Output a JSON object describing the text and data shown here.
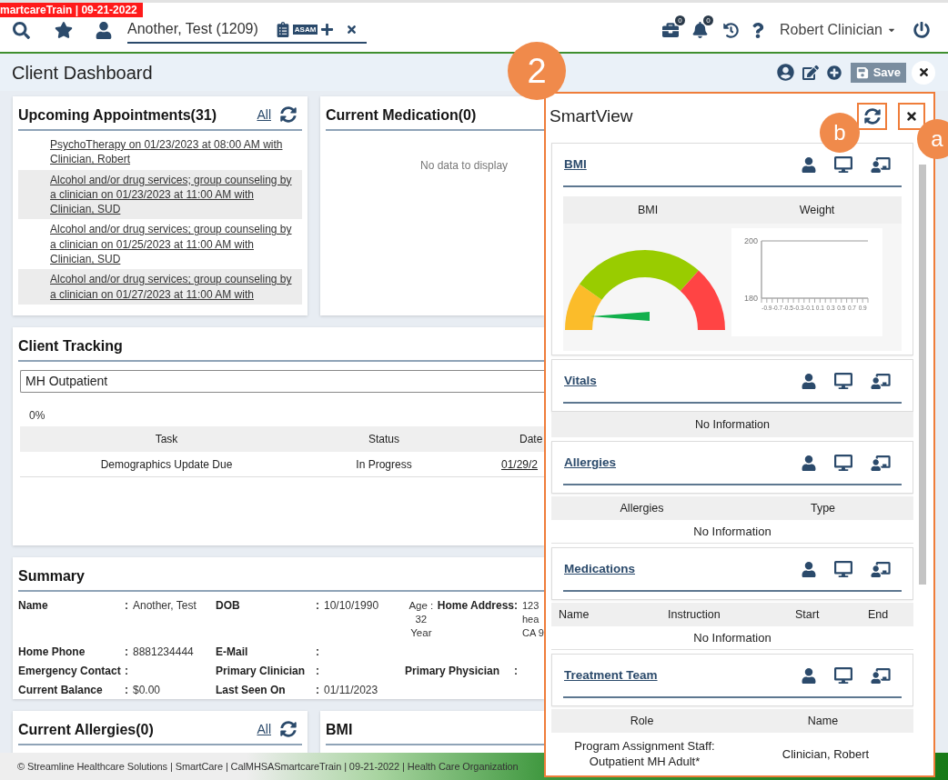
{
  "env_label": "martcareTrain | 09-21-2022",
  "topbar": {
    "client": "Another, Test (1209)",
    "badge": "ASAM",
    "briefcase_count": "0",
    "bell_count": "0",
    "user": "Robert Clinician"
  },
  "page": {
    "title": "Client Dashboard",
    "save": "Save"
  },
  "appointments": {
    "title": "Upcoming Appointments(31)",
    "all_link": "All",
    "items": [
      "PsychoTherapy on 01/23/2023 at 08:00 AM with Clinician, Robert",
      "Alcohol and/or drug services; group counseling by a clinician on 01/23/2023 at 11:00 AM with Clinician, SUD",
      "Alcohol and/or drug services; group counseling by a clinician on 01/25/2023 at 11:00 AM with Clinician, SUD",
      "Alcohol and/or drug services; group counseling by a clinician on 01/27/2023 at 11:00 AM with"
    ]
  },
  "medication": {
    "title": "Current Medication(0)",
    "empty": "No data to display"
  },
  "tracking": {
    "title": "Client Tracking",
    "program": "MH Outpatient",
    "progress": "0%",
    "columns": [
      "Task",
      "Status",
      "Date"
    ],
    "rows": [
      [
        "Demographics Update Due",
        "In Progress",
        "01/29/2"
      ]
    ]
  },
  "summary": {
    "title": "Summary",
    "rows": [
      [
        {
          "label": "Name",
          "sep": ":",
          "value": "Another, Test"
        },
        {
          "label": "DOB",
          "sep": ":",
          "value": "10/10/1990"
        },
        {
          "note": "Age : 32 Year",
          "label": "Home Address",
          "sep": ":",
          "value": "123 hea CA 9"
        }
      ],
      [
        {
          "label": "Home Phone",
          "sep": ":",
          "value": "8881234444"
        },
        {
          "label": "E-Mail",
          "sep": ":"
        }
      ],
      [
        {
          "label": "Emergency Contact",
          "sep": ":"
        },
        {
          "label": "Primary Clinician",
          "sep": ":"
        },
        {
          "label": "Primary Physician",
          "sep": ":"
        }
      ],
      [
        {
          "label": "Current Balance",
          "sep": ":",
          "value": "$0.00"
        },
        {
          "label": "Last Seen On",
          "sep": ":",
          "value": "01/11/2023"
        }
      ]
    ]
  },
  "allergies": {
    "title": "Current Allergies(0)",
    "all_link": "All"
  },
  "bmi_card": {
    "title": "BMI"
  },
  "footer": "© Streamline Healthcare Solutions | SmartCare | CalMHSASmartcareTrain | 09-21-2022 | Health Care Organization",
  "smartview": {
    "title": "SmartView",
    "refresh_highlighted": true,
    "close_highlighted": true,
    "sections": [
      {
        "kind": "charts",
        "title": "BMI",
        "gauge_label": "BMI",
        "chart_data": {
          "type": "line",
          "title": "Weight",
          "xlim": [
            -1,
            1
          ],
          "ylim": [
            180,
            200
          ],
          "yticks": [
            180,
            200
          ],
          "xticks": [
            -0.9,
            -0.7,
            -0.5,
            -0.3,
            -0.1,
            0.1,
            0.3,
            0.5,
            0.7,
            0.9
          ]
        }
      },
      {
        "kind": "message",
        "title": "Vitals",
        "message": "No Information"
      },
      {
        "kind": "table",
        "title": "Allergies",
        "columns": [
          "Allergies",
          "Type"
        ],
        "message": "No Information"
      },
      {
        "kind": "table",
        "title": "Medications",
        "columns": [
          "Name",
          "Instruction",
          "Start",
          "End"
        ],
        "message": "No Information"
      },
      {
        "kind": "table",
        "title": "Treatment Team",
        "columns": [
          "Role",
          "Name"
        ],
        "rows": [
          [
            "Program Assignment Staff: Outpatient MH Adult*",
            "Clinician, Robert"
          ]
        ]
      }
    ]
  },
  "callouts": [
    "2",
    "b",
    "a"
  ]
}
